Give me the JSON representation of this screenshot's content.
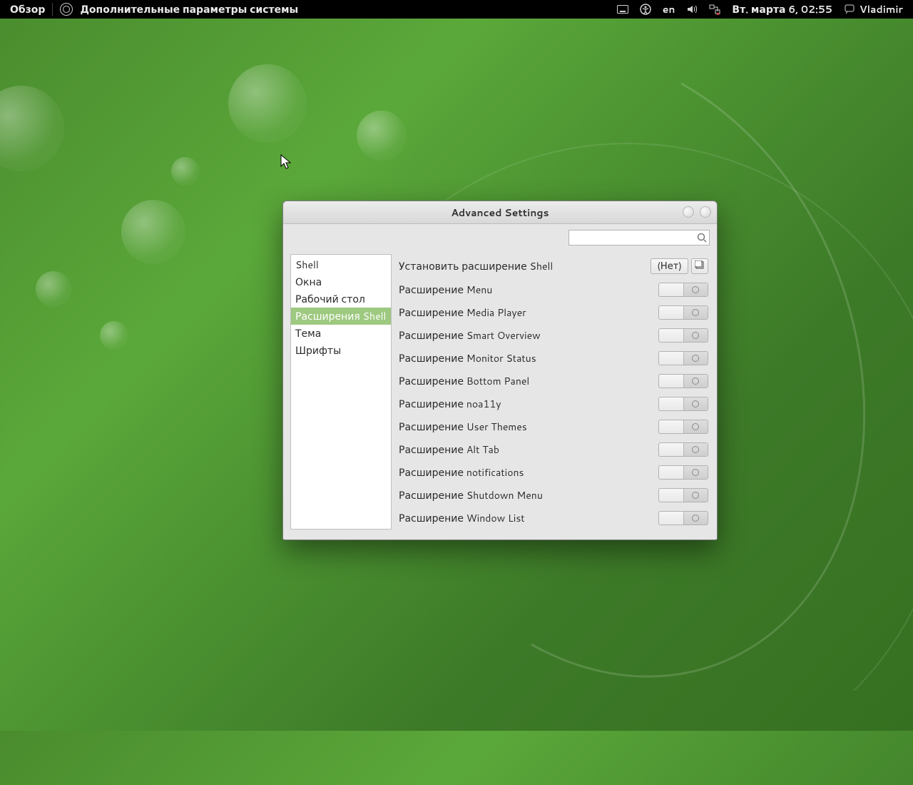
{
  "panel": {
    "activities": "Обзор",
    "app_title": "Дополнительные параметры системы",
    "lang": "en",
    "datetime": "Вт. марта  6, 02:55",
    "username": "Vladimir"
  },
  "window": {
    "title": "Advanced Settings",
    "search_placeholder": ""
  },
  "sidebar": {
    "items": [
      {
        "label": "Shell",
        "selected": false
      },
      {
        "label": "Окна",
        "selected": false
      },
      {
        "label": "Рабочий стол",
        "selected": false
      },
      {
        "label": "Расширения Shell",
        "selected": true
      },
      {
        "label": "Тема",
        "selected": false
      },
      {
        "label": "Шрифты",
        "selected": false
      }
    ]
  },
  "content": {
    "install_label": "Установить расширение Shell",
    "install_value": "(Нет)",
    "extensions": [
      {
        "label": "Расширение Menu",
        "on": false
      },
      {
        "label": "Расширение Media Player",
        "on": false
      },
      {
        "label": "Расширение Smart Overview",
        "on": false
      },
      {
        "label": "Расширение Monitor Status",
        "on": false
      },
      {
        "label": "Расширение Bottom Panel",
        "on": false
      },
      {
        "label": "Расширение noa11y",
        "on": false
      },
      {
        "label": "Расширение User Themes",
        "on": false
      },
      {
        "label": "Расширение Alt Tab",
        "on": false
      },
      {
        "label": "Расширение notifications",
        "on": false
      },
      {
        "label": "Расширение Shutdown Menu",
        "on": false
      },
      {
        "label": "Расширение Window List",
        "on": false
      }
    ]
  }
}
